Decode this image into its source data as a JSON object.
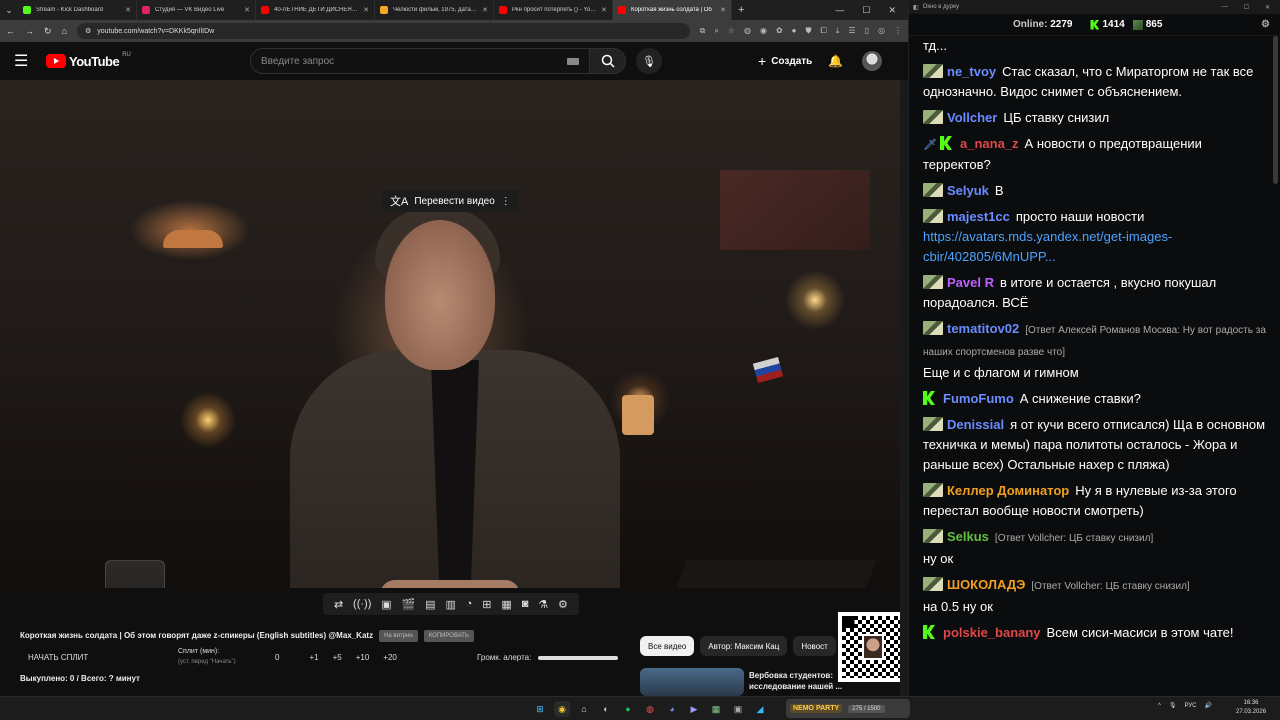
{
  "browser": {
    "tabs": [
      {
        "label": "Stream - Kick Dashboard",
        "color": "#53fc18",
        "active": false
      },
      {
        "label": "Студия — VK Видео Live",
        "color": "#e0245e",
        "active": false
      },
      {
        "label": "40-ЛЕТНИЕ ДЕТИ ДИСНЕЯ - Y",
        "color": "#ff0000",
        "active": false
      },
      {
        "label": "Челюсти фильм, 1975, дата вы",
        "color": "#f5a623",
        "active": false
      },
      {
        "label": "Ркн просит потерпеть () - YouT",
        "color": "#ff0000",
        "active": false
      },
      {
        "label": "Короткая жизнь солдата | Об",
        "color": "#ff0000",
        "active": true
      }
    ],
    "url": "youtube.com/watch?v=DKKk5qnIlIDw"
  },
  "youtube": {
    "logo_text": "YouTube",
    "logo_region": "RU",
    "search_placeholder": "Введите запрос",
    "create_label": "Создать",
    "translate_label": "Перевести видео",
    "video_title": "Короткая жизнь солдата | Об этом говорят даже z-спикеры (English subtitles) @Max_Katz",
    "title_btn1": "На витрин",
    "title_btn2": "КОПИРОВАТЬ",
    "chips": [
      "Все видео",
      "Автор: Максим Кац",
      "Новост"
    ],
    "rec_title": "Вербовка студентов: исследование нашей ..."
  },
  "split": {
    "start_label": "НАЧАТЬ СПЛИТ",
    "min_label": "Сплит (мин):",
    "min_sub": "(уст. перед \"Начать\")",
    "values": [
      "0",
      "+1",
      "+5",
      "+10",
      "+20"
    ],
    "alert_label": "Громк. алерта:",
    "paid": "Выкуплено: 0 / Всего: ? минут"
  },
  "chat": {
    "window_title": "Окно в дуреу",
    "online_label": "Online:",
    "online_value": "2279",
    "kick_count": "1414",
    "twitch_count": "865",
    "messages": [
      {
        "user": "",
        "color": "#fff",
        "text": "тд...",
        "reply": "",
        "badge": "none"
      },
      {
        "user": "ne_tvoy",
        "color": "#6a8cff",
        "text": "Стас сказал, что с Мираторгом не так все однозначно. Видос снимет с объяснением.",
        "reply": "",
        "badge": "sub"
      },
      {
        "user": "Vollcher",
        "color": "#6a8cff",
        "text": "ЦБ ставку снизил",
        "reply": "",
        "badge": "sub"
      },
      {
        "user": "a_nana_z",
        "color": "#e04848",
        "text": "А новости о предотвращении терректов?",
        "reply": "",
        "badge": "mod-kick"
      },
      {
        "user": "Selyuk",
        "color": "#6a8cff",
        "text": "В",
        "reply": "",
        "badge": "sub"
      },
      {
        "user": "majest1cc",
        "color": "#6a8cff",
        "text": "просто наши новости",
        "link": "https://avatars.mds.yandex.net/get-images-cbir/402805/6MnUPP...",
        "reply": "",
        "badge": "sub"
      },
      {
        "user": "Pavel R",
        "color": "#c060ff",
        "text": "в итоге и остается , вкусно покушал порадоался. ВСЁ",
        "reply": "",
        "badge": "sub"
      },
      {
        "user": "tematitov02",
        "color": "#6a8cff",
        "text": "Еще и с флагом и гимном",
        "reply": "[Ответ Алексей Романов Москва: Ну вот радость за наших спортсменов разве что]",
        "badge": "sub"
      },
      {
        "user": "FumoFumo",
        "color": "#6a8cff",
        "text": "А снижение ставки?",
        "reply": "",
        "badge": "kick"
      },
      {
        "user": "Denissial",
        "color": "#6a8cff",
        "text": "я от кучи всего отписался) Ща в основном техничка и мемы) пара политоты осталось - Жора и раньше всех) Остальные нахер с пляжа)",
        "reply": "",
        "badge": "sub"
      },
      {
        "user": "Келлер Доминатор",
        "color": "#f0a020",
        "text": "Ну я в нулевые из-за этого перестал вообще новости смотреть)",
        "reply": "",
        "badge": "sub"
      },
      {
        "user": "Selkus",
        "color": "#60c040",
        "text": "ну ок",
        "reply": "[Ответ Vollcher: ЦБ ставку снизил]",
        "badge": "sub"
      },
      {
        "user": "ШОКОЛАДЭ",
        "color": "#f0a020",
        "text": "на 0.5 ну ок",
        "reply": "[Ответ Vollcher: ЦБ ставку снизил]",
        "badge": "sub"
      },
      {
        "user": "polskie_banany",
        "color": "#e04848",
        "text": "Всем сиси-масиси в этом чате!",
        "reply": "",
        "badge": "kick"
      }
    ]
  },
  "taskbar": {
    "nemo_label": "NEMO PARTY",
    "nemo_count": "275 / 1500",
    "lang": "РУС",
    "time": "16:36",
    "date": "27.03.2026"
  }
}
